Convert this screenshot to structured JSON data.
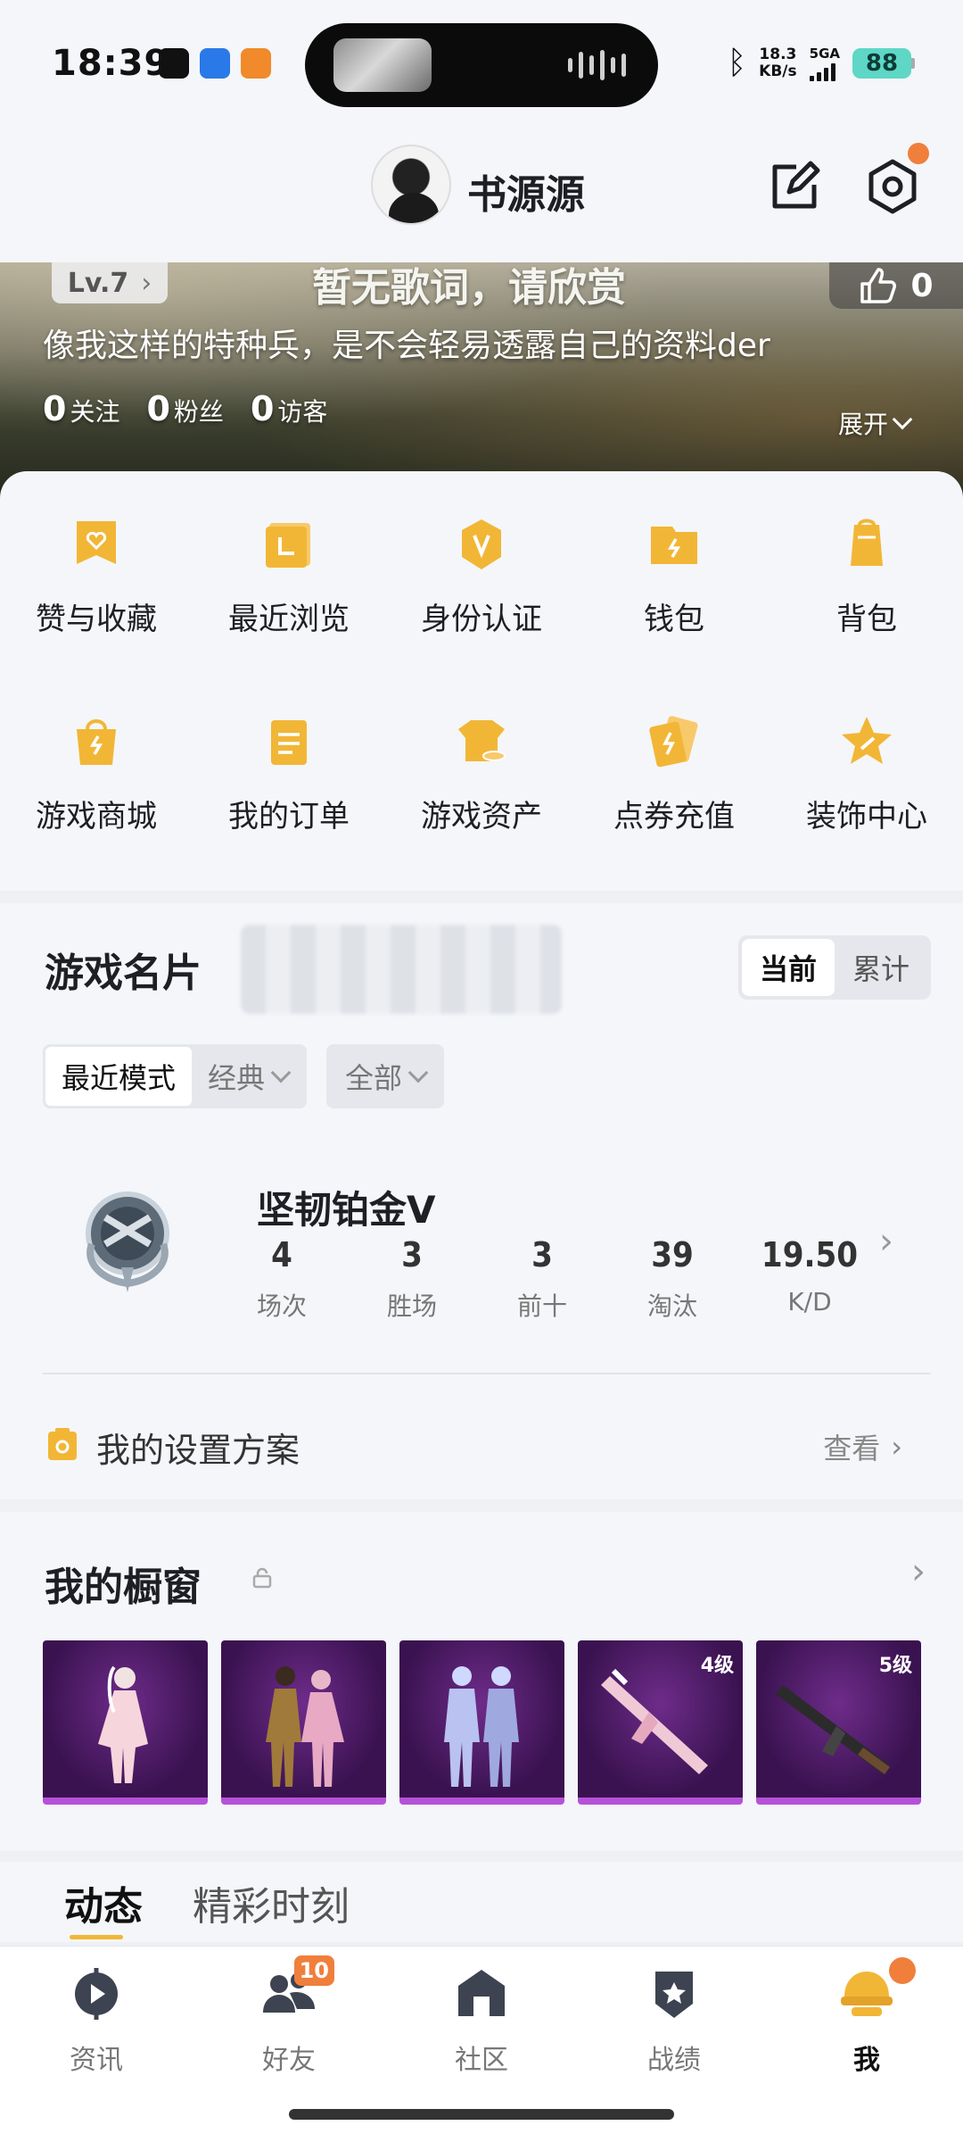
{
  "status_bar": {
    "time": "18:39",
    "speed_value": "18.3",
    "speed_unit": "KB/s",
    "network": "5GA",
    "battery": "88"
  },
  "header": {
    "username": "书源源",
    "colors": {
      "accent": "#f2b636",
      "dot": "#f07f3c"
    }
  },
  "banner": {
    "level": "Lv.7",
    "lyrics": "暂无歌词，请欣赏",
    "likes": "0",
    "bio": "像我这样的特种兵，是不会轻易透露自己的资料der",
    "stats": [
      {
        "value": "0",
        "label": "关注"
      },
      {
        "value": "0",
        "label": "粉丝"
      },
      {
        "value": "0",
        "label": "访客"
      }
    ],
    "expand": "展开"
  },
  "grid": {
    "items": [
      {
        "label": "赞与收藏",
        "icon": "like-collect-icon"
      },
      {
        "label": "最近浏览",
        "icon": "recent-browse-icon"
      },
      {
        "label": "身份认证",
        "icon": "verify-icon"
      },
      {
        "label": "钱包",
        "icon": "wallet-icon"
      },
      {
        "label": "背包",
        "icon": "backpack-icon"
      },
      {
        "label": "游戏商城",
        "icon": "shop-icon"
      },
      {
        "label": "我的订单",
        "icon": "orders-icon"
      },
      {
        "label": "游戏资产",
        "icon": "assets-icon"
      },
      {
        "label": "点券充值",
        "icon": "recharge-icon"
      },
      {
        "label": "装饰中心",
        "icon": "decor-icon"
      }
    ]
  },
  "game": {
    "title": "游戏名片",
    "toggle": {
      "current": "当前",
      "total": "累计"
    },
    "filters": {
      "mode": "最近模式",
      "classic": "经典",
      "all": "全部"
    },
    "rank": {
      "name": "坚韧铂金Ⅴ",
      "stats": [
        {
          "value": "4",
          "label": "场次"
        },
        {
          "value": "3",
          "label": "胜场"
        },
        {
          "value": "3",
          "label": "前十"
        },
        {
          "value": "39",
          "label": "淘汰"
        },
        {
          "value": "19.50",
          "label": "K/D"
        }
      ]
    },
    "settings": {
      "label": "我的设置方案",
      "view": "查看"
    }
  },
  "showcase": {
    "title": "我的橱窗",
    "items": [
      {
        "level": ""
      },
      {
        "level": ""
      },
      {
        "level": ""
      },
      {
        "level": "4级"
      },
      {
        "level": "5级"
      }
    ]
  },
  "tabs": {
    "items": [
      "动态",
      "精彩时刻"
    ]
  },
  "bottom_nav": {
    "items": [
      {
        "label": "资讯",
        "icon": "news-icon"
      },
      {
        "label": "好友",
        "icon": "friends-icon",
        "badge": "10"
      },
      {
        "label": "社区",
        "icon": "community-icon"
      },
      {
        "label": "战绩",
        "icon": "record-icon"
      },
      {
        "label": "我",
        "icon": "me-icon"
      }
    ]
  }
}
